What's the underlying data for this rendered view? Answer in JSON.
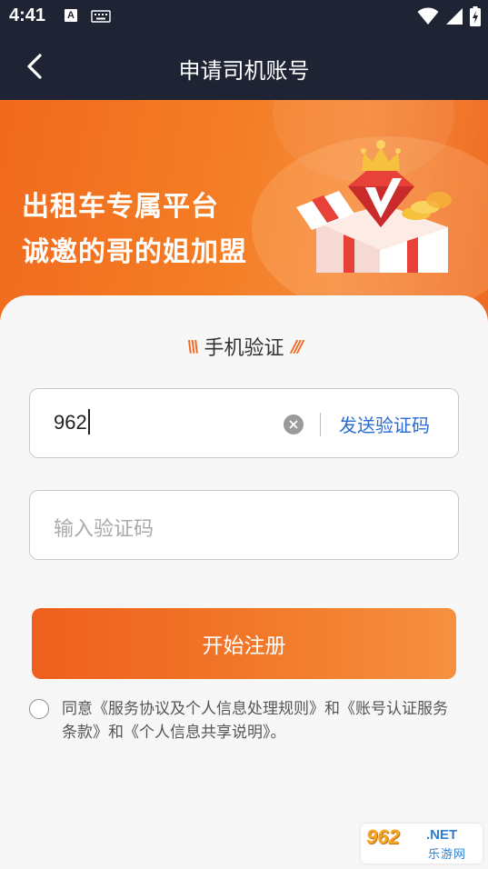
{
  "status_bar": {
    "time": "4:41",
    "a_badge": "A",
    "icons": [
      "a-notification-icon",
      "keyboard-icon",
      "wifi-icon",
      "signal-icon",
      "battery-charging-icon"
    ]
  },
  "nav": {
    "title": "申请司机账号",
    "back_icon": "chevron-left-icon"
  },
  "banner": {
    "line1": "出租车专属平台",
    "line2": "诚邀的哥的姐加盟"
  },
  "form": {
    "section_title": "手机验证",
    "phone_value": "962",
    "send_code_label": "发送验证码",
    "code_placeholder": "输入验证码",
    "code_value": "",
    "register_label": "开始注册"
  },
  "agreement": {
    "prefix": "同意",
    "link1": "《服务协议及个人信息处理规则》",
    "and1": "和",
    "link2": "《账号认证服务条款》",
    "and2": "和",
    "link3": "《个人信息共享说明》",
    "suffix": "。",
    "checked": false
  },
  "watermark": {
    "main": "962",
    "net": ".NET",
    "sub": "乐游网"
  },
  "colors": {
    "header_bg": "#1f2434",
    "accent_orange": "#f06a22",
    "link_blue": "#2a6bd4",
    "page_bg": "#f7f7f8"
  }
}
